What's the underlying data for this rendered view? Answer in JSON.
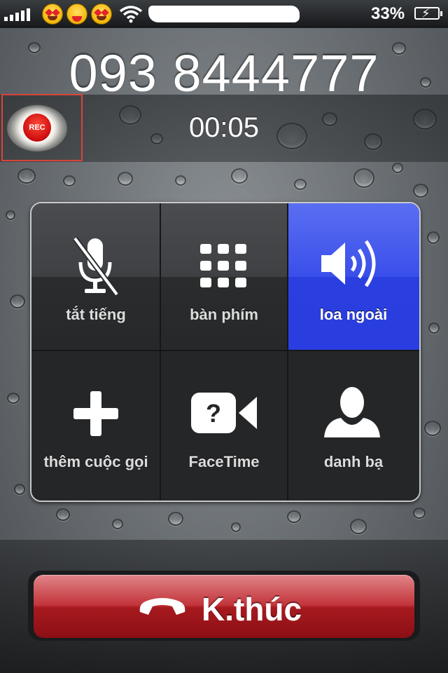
{
  "status_bar": {
    "battery_percent": "33%",
    "signal_bars": 5,
    "emoji_icons": [
      "heart-eyes-emoji-icon",
      "winking-tongue-emoji-icon",
      "heart-eyes-emoji-icon"
    ],
    "wifi_icon": "wifi-icon",
    "battery_icon": "battery-charging-icon"
  },
  "call": {
    "number": "093 8444777",
    "duration": "00:05"
  },
  "recorder": {
    "label": "REC",
    "accent": "#d9443a"
  },
  "controls": [
    {
      "label": "tắt tiếng",
      "icon": "mute-icon",
      "active": false
    },
    {
      "label": "bàn phím",
      "icon": "keypad-icon",
      "active": false
    },
    {
      "label": "loa ngoài",
      "icon": "speaker-icon",
      "active": true
    },
    {
      "label": "thêm cuộc gọi",
      "icon": "add-call-icon",
      "active": false
    },
    {
      "label": "FaceTime",
      "icon": "facetime-icon",
      "active": false
    },
    {
      "label": "danh bạ",
      "icon": "contacts-icon",
      "active": false
    }
  ],
  "end_call": {
    "label": "K.thúc",
    "icon": "hang-up-phone-icon",
    "color": "#a61a1f"
  },
  "colors": {
    "active_blue": "#3a4fea"
  }
}
